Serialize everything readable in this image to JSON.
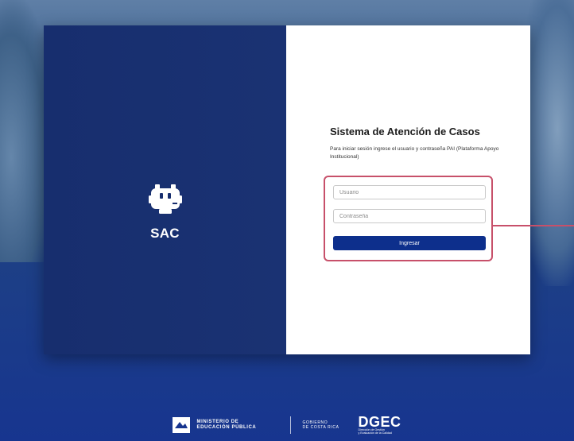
{
  "brand": {
    "name": "SAC"
  },
  "login": {
    "title": "Sistema de Atención de Casos",
    "subtitle": "Para iniciar sesión ingrese el usuario y contraseña PAI (Plataforma Apoyo Institucional)",
    "username_placeholder": "Usuario",
    "username_value": "",
    "password_placeholder": "Contraseña",
    "password_value": "",
    "submit_label": "Ingresar"
  },
  "footer": {
    "ministry_line1": "MINISTERIO DE",
    "ministry_line2": "EDUCACIÓN PÚBLICA",
    "gov_line1": "GOBIERNO",
    "gov_line2": "DE COSTA RICA",
    "dgec_title": "DGEC",
    "dgec_sub1": "Dirección de Gestión",
    "dgec_sub2": "y Evaluación de la Calidad"
  },
  "colors": {
    "panel_dark_blue": "#172e6e",
    "button_blue": "#0d2f8c",
    "highlight_red": "#c7506a",
    "background_blue": "#17358f"
  },
  "icons": {
    "brand_logo": "robot-head-icon",
    "footer_crest": "mep-crest-icon"
  }
}
